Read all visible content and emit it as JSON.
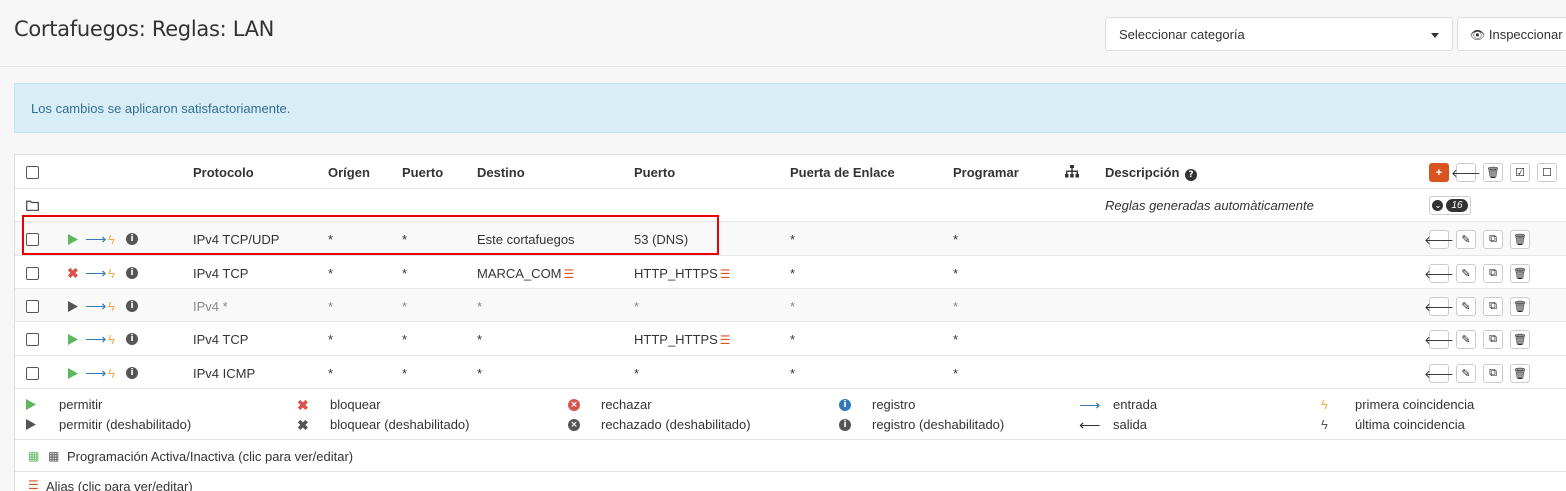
{
  "page": {
    "title": "Cortafuegos: Reglas: LAN"
  },
  "toolbar": {
    "category_placeholder": "Seleccionar categoría",
    "inspect_label": "Inspeccionar"
  },
  "alert": {
    "message": "Los cambios se aplicaron satisfactoriamente."
  },
  "table": {
    "headers": {
      "protocol": "Protocolo",
      "source": "Orígen",
      "source_port": "Puerto",
      "destination": "Destino",
      "dest_port": "Puerto",
      "gateway": "Puerta de Enlace",
      "schedule": "Programar",
      "description": "Descripción"
    },
    "auto_rules": {
      "label": "Reglas generadas automàticamente",
      "count": "16"
    },
    "rows": [
      {
        "action": "pass",
        "protocol": "IPv4 TCP/UDP",
        "source": "*",
        "source_port": "*",
        "destination": "Este cortafuegos",
        "dest_port": "53 (DNS)",
        "gateway": "*",
        "schedule": "*",
        "description": ""
      },
      {
        "action": "block",
        "protocol": "IPv4 TCP",
        "source": "*",
        "source_port": "*",
        "destination": "MARCA_COM",
        "dest_port": "HTTP_HTTPS",
        "gateway": "*",
        "schedule": "*",
        "description": ""
      },
      {
        "action": "pass-disabled",
        "protocol": "IPv4 *",
        "source": "*",
        "source_port": "*",
        "destination": "*",
        "dest_port": "*",
        "gateway": "*",
        "schedule": "*",
        "description": ""
      },
      {
        "action": "pass",
        "protocol": "IPv4 TCP",
        "source": "*",
        "source_port": "*",
        "destination": "*",
        "dest_port": "HTTP_HTTPS",
        "gateway": "*",
        "schedule": "*",
        "description": ""
      },
      {
        "action": "pass",
        "protocol": "IPv4 ICMP",
        "source": "*",
        "source_port": "*",
        "destination": "*",
        "dest_port": "*",
        "gateway": "*",
        "schedule": "*",
        "description": ""
      }
    ]
  },
  "legend": {
    "pass": "permitir",
    "pass_disabled": "permitir (deshabilitado)",
    "block": "bloquear",
    "block_disabled": "bloquear (deshabilitado)",
    "reject": "rechazar",
    "reject_disabled": "rechazado (deshabilitado)",
    "log": "registro",
    "log_disabled": "registro (deshabilitado)",
    "in": "entrada",
    "out": "salida",
    "first_match": "primera coincidencia",
    "last_match": "última coincidencia",
    "schedule_note": "Programación Activa/Inactiva (clic para ver/editar)",
    "alias_note": "Alias (clic para ver/editar)"
  },
  "colors": {
    "accent": "#d9531e",
    "pass": "#5cb85c",
    "block": "#d9534f",
    "disabled": "#555555",
    "alert_bg": "#d9edf7"
  }
}
